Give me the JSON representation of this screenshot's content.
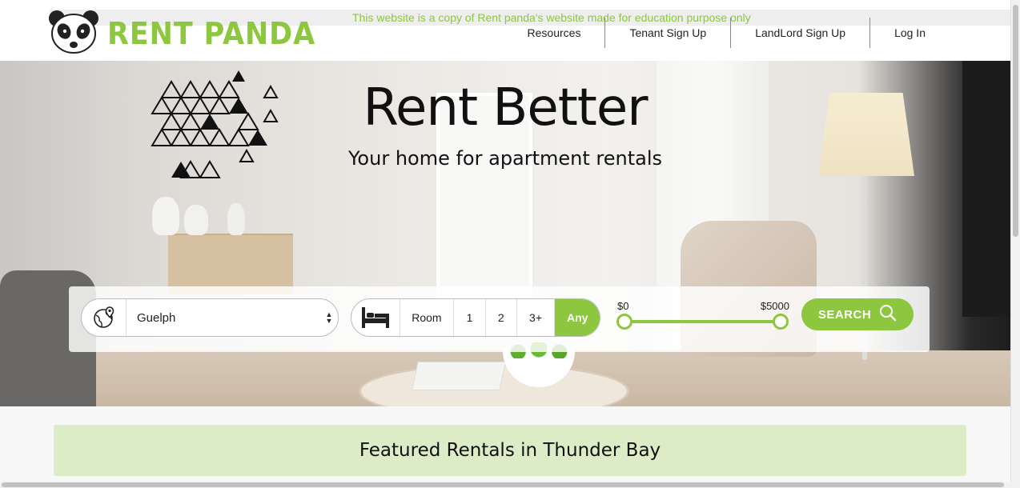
{
  "brand": {
    "name": "RENT PANDA",
    "logo_icon": "panda-icon",
    "color": "#8dc63f"
  },
  "notice": "This website is a copy of Rent panda's website made for education purpose only",
  "nav": {
    "items": [
      {
        "label": "Resources"
      },
      {
        "label": "Tenant Sign Up"
      },
      {
        "label": "LandLord Sign Up"
      },
      {
        "label": "Log In"
      }
    ]
  },
  "hero": {
    "title": "Rent Better",
    "subtitle": "Your home for apartment rentals"
  },
  "search": {
    "location": {
      "icon": "globe-pin-icon",
      "value": "Guelph"
    },
    "bedrooms": {
      "icon": "bed-icon",
      "options": [
        "Room",
        "1",
        "2",
        "3+",
        "Any"
      ],
      "selected": "Any"
    },
    "price": {
      "min_label": "$0",
      "max_label": "$5000",
      "min_fraction": 0,
      "max_fraction": 1
    },
    "button_label": "SEARCH",
    "button_icon": "search-icon"
  },
  "featured": {
    "title": "Featured Rentals in Thunder Bay"
  }
}
